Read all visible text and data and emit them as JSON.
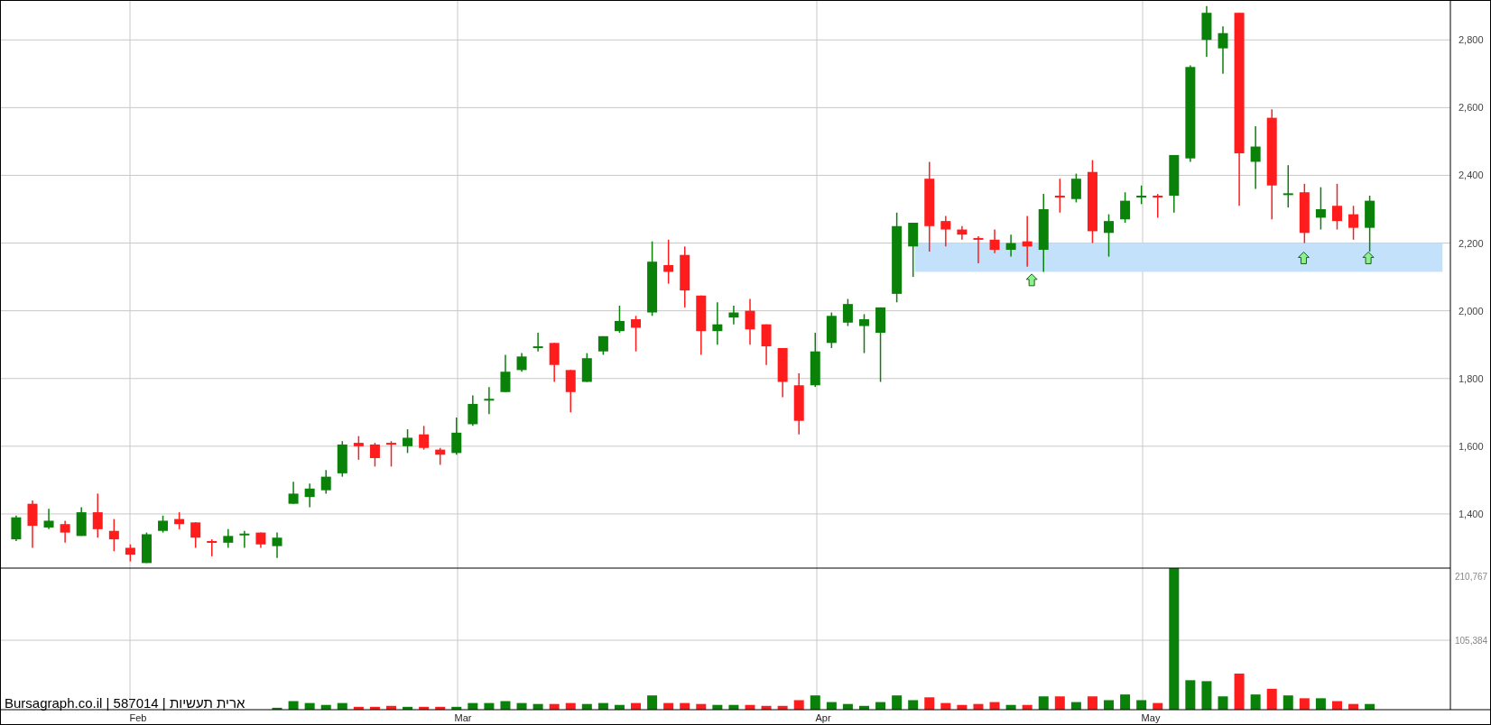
{
  "price_axis": {
    "ticks": [
      "2,800",
      "2,600",
      "2,400",
      "2,200",
      "2,000",
      "1,800",
      "1,600",
      "1,400"
    ]
  },
  "volume_axis": {
    "ticks": [
      "210,767",
      "105,384"
    ]
  },
  "time_axis": {
    "labels": [
      "Feb",
      "Mar",
      "Apr",
      "May"
    ]
  },
  "caption": "Bursagraph.co.il | 587014 | ארית תעשיות"
}
